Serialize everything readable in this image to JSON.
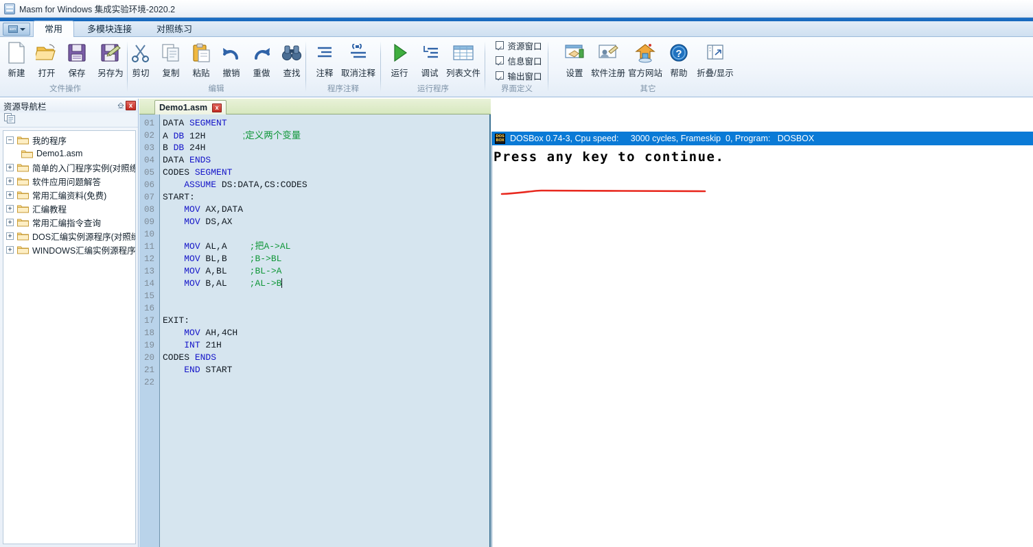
{
  "window": {
    "title": "Masm for Windows 集成实验环境-2020.2",
    "icon": "app-icon"
  },
  "ribbon": {
    "tabs": [
      {
        "label": "常用",
        "active": true
      },
      {
        "label": "多模块连接",
        "active": false
      },
      {
        "label": "对照练习",
        "active": false
      }
    ],
    "groups": [
      {
        "label": "文件操作",
        "buttons": [
          {
            "label": "新建",
            "icon": "new-file-icon"
          },
          {
            "label": "打开",
            "icon": "open-folder-icon"
          },
          {
            "label": "保存",
            "icon": "save-icon"
          },
          {
            "label": "另存为",
            "icon": "save-as-icon"
          }
        ]
      },
      {
        "label": "编辑",
        "buttons": [
          {
            "label": "剪切",
            "icon": "scissors-icon"
          },
          {
            "label": "复制",
            "icon": "copy-icon"
          },
          {
            "label": "粘贴",
            "icon": "paste-icon"
          },
          {
            "label": "撤销",
            "icon": "undo-icon"
          },
          {
            "label": "重做",
            "icon": "redo-icon"
          },
          {
            "label": "查找",
            "icon": "binoculars-icon"
          }
        ]
      },
      {
        "label": "程序注释",
        "buttons": [
          {
            "label": "注释",
            "icon": "comment-icon"
          },
          {
            "label": "取消注释",
            "icon": "uncomment-icon"
          }
        ]
      },
      {
        "label": "运行程序",
        "buttons": [
          {
            "label": "运行",
            "icon": "play-icon"
          },
          {
            "label": "调试",
            "icon": "debug-icon"
          },
          {
            "label": "列表文件",
            "icon": "table-icon"
          }
        ]
      },
      {
        "label": "界面定义",
        "checkboxes": [
          {
            "label": "资源窗口",
            "checked": true
          },
          {
            "label": "信息窗口",
            "checked": true
          },
          {
            "label": "输出窗口",
            "checked": true
          }
        ]
      },
      {
        "label": "其它",
        "buttons": [
          {
            "label": "设置",
            "icon": "settings-icon"
          },
          {
            "label": "软件注册",
            "icon": "register-icon"
          },
          {
            "label": "官方网站",
            "icon": "home-icon"
          },
          {
            "label": "帮助",
            "icon": "help-icon"
          },
          {
            "label": "折叠/显示",
            "icon": "collapse-icon"
          }
        ]
      }
    ]
  },
  "sidebar": {
    "title": "资源导航栏",
    "pin_icon": "pin-icon",
    "close_label": "x",
    "toolbar_icon": "copy-list-icon",
    "tree": [
      {
        "label": "我的程序",
        "expander": "-",
        "level": 0
      },
      {
        "label": "Demo1.asm",
        "expander": "",
        "level": 1
      },
      {
        "label": "简单的入门程序实例(对照练习",
        "expander": "+",
        "level": 0
      },
      {
        "label": "软件应用问题解答",
        "expander": "+",
        "level": 0
      },
      {
        "label": "常用汇编资料(免费)",
        "expander": "+",
        "level": 0
      },
      {
        "label": "汇编教程",
        "expander": "+",
        "level": 0
      },
      {
        "label": "常用汇编指令查询",
        "expander": "+",
        "level": 0
      },
      {
        "label": "DOS汇编实例源程序(对照练习",
        "expander": "+",
        "level": 0
      },
      {
        "label": "WINDOWS汇编实例源程序(对",
        "expander": "+",
        "level": 0
      }
    ]
  },
  "editor": {
    "tab": {
      "name": "Demo1.asm",
      "close_label": "x"
    },
    "line_numbers": [
      "01",
      "02",
      "03",
      "04",
      "05",
      "06",
      "07",
      "08",
      "09",
      "10",
      "11",
      "12",
      "13",
      "14",
      "15",
      "16",
      "17",
      "18",
      "19",
      "20",
      "21",
      "22"
    ],
    "lines": [
      {
        "n": "01",
        "code": "DATA SEGMENT",
        "comment": ""
      },
      {
        "n": "02",
        "code": "A DB 12H",
        "comment": ";定义两个变量"
      },
      {
        "n": "03",
        "code": "B DB 24H",
        "comment": ""
      },
      {
        "n": "04",
        "code": "DATA ENDS",
        "comment": ""
      },
      {
        "n": "05",
        "code": "CODES SEGMENT",
        "comment": ""
      },
      {
        "n": "06",
        "code": "    ASSUME DS:DATA,CS:CODES",
        "comment": ""
      },
      {
        "n": "07",
        "code": "START:",
        "comment": ""
      },
      {
        "n": "08",
        "code": "    MOV AX,DATA",
        "comment": ""
      },
      {
        "n": "09",
        "code": "    MOV DS,AX",
        "comment": ""
      },
      {
        "n": "10",
        "code": "",
        "comment": ""
      },
      {
        "n": "11",
        "code": "    MOV AL,A",
        "comment": ";把A->AL"
      },
      {
        "n": "12",
        "code": "    MOV BL,B",
        "comment": ";B->BL"
      },
      {
        "n": "13",
        "code": "    MOV A,BL",
        "comment": ";BL->A"
      },
      {
        "n": "14",
        "code": "    MOV B,AL",
        "comment": ";AL->B"
      },
      {
        "n": "15",
        "code": "",
        "comment": ""
      },
      {
        "n": "16",
        "code": "",
        "comment": ""
      },
      {
        "n": "17",
        "code": "EXIT:",
        "comment": ""
      },
      {
        "n": "18",
        "code": "    MOV AH,4CH",
        "comment": ""
      },
      {
        "n": "19",
        "code": "    INT 21H",
        "comment": ""
      },
      {
        "n": "20",
        "code": "CODES ENDS",
        "comment": ""
      },
      {
        "n": "21",
        "code": "    END START",
        "comment": ""
      },
      {
        "n": "22",
        "code": "",
        "comment": ""
      }
    ]
  },
  "dosbox": {
    "title": "DOSBox 0.74-3, Cpu speed:     3000 cycles, Frameskip  0, Program:   DOSBOX",
    "logo": {
      "top": "DOS",
      "bottom": "BOX"
    },
    "output": "Press any key to continue."
  },
  "annotations": {
    "run_underline_color": "#e8281e",
    "dos_underline_color": "#e8281e"
  },
  "colors": {
    "titlebar_accent": "#1668bd",
    "ribbon_bg": "#eef4fb",
    "dosbox_title": "#0a7ad6",
    "keyword": "#1414c8",
    "comment": "#0f9638",
    "gutter": "#b9d3ea",
    "code_bg": "#d6e5ef"
  }
}
